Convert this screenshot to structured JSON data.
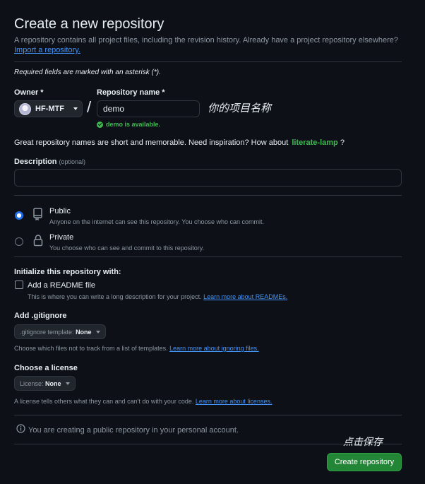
{
  "header": {
    "title": "Create a new repository",
    "subtitle": "A repository contains all project files, including the revision history. Already have a project repository elsewhere?",
    "import_link": "Import a repository."
  },
  "required_note": "Required fields are marked with an asterisk (*).",
  "owner": {
    "label": "Owner *",
    "value": "HF-MTF"
  },
  "separator": "/",
  "repo_name": {
    "label": "Repository name *",
    "value": "demo",
    "annotation": "你的项目名称",
    "availability": "demo is available."
  },
  "inspiration": {
    "text": "Great repository names are short and memorable. Need inspiration? How about",
    "suggestion": "literate-lamp",
    "end": "?"
  },
  "description": {
    "label": "Description",
    "optional": "(optional)",
    "value": ""
  },
  "visibility": {
    "selected": "Public",
    "options": [
      {
        "title": "Public",
        "description": "Anyone on the internet can see this repository. You choose who can commit.",
        "icon": "repo-icon"
      },
      {
        "title": "Private",
        "description": "You choose who can see and commit to this repository.",
        "icon": "lock-icon"
      }
    ]
  },
  "initialize": {
    "title": "Initialize this repository with:",
    "readme_label": "Add a README file",
    "readme_checked": false,
    "readme_note": "This is where you can write a long description for your project.",
    "readme_link": "Learn more about READMEs."
  },
  "gitignore": {
    "title": "Add .gitignore",
    "select_prefix": ".gitignore template:",
    "select_value": "None",
    "note": "Choose which files not to track from a list of templates.",
    "link": "Learn more about ignoring files."
  },
  "license": {
    "title": "Choose a license",
    "select_prefix": "License:",
    "select_value": "None",
    "note": "A license tells others what they can and can't do with your code.",
    "link": "Learn more about licenses."
  },
  "info": {
    "icon": "info-icon",
    "text": "You are creating a public repository in your personal account."
  },
  "footer": {
    "annotation": "点击保存",
    "create_button": "Create repository"
  },
  "colors": {
    "background": "#0d1117",
    "accent_green": "#238636",
    "link_blue": "#4493f8",
    "success_green": "#3fb950",
    "border": "#30363d"
  }
}
